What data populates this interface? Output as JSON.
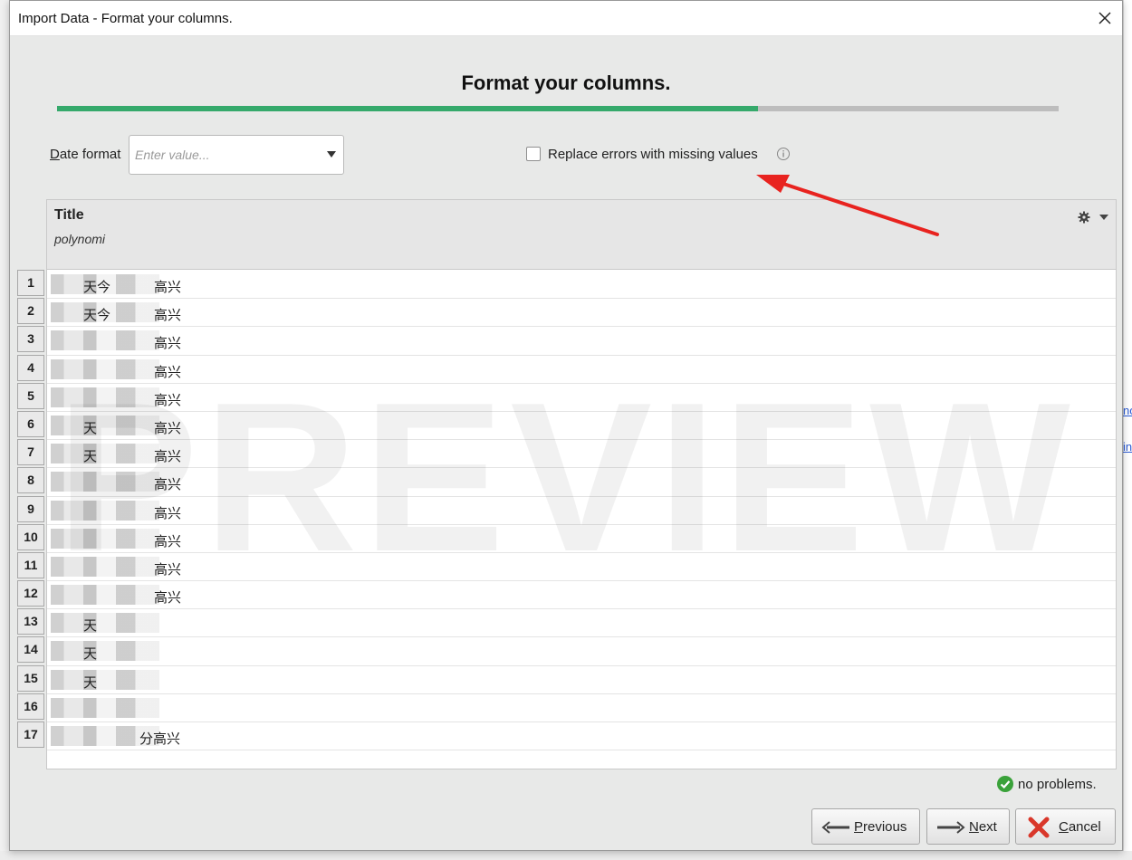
{
  "window": {
    "title": "Import Data - Format your columns."
  },
  "wizard": {
    "heading": "Format your columns.",
    "progress_fraction": 0.7,
    "progress_color": "#35a96b"
  },
  "date_format": {
    "label": "Date format",
    "placeholder": "Enter value..."
  },
  "replace_errors": {
    "label": "Replace errors with missing values",
    "checked": false
  },
  "column": {
    "title": "Title",
    "type_hint": "polynomi"
  },
  "rows": [
    {
      "num": "1",
      "text": "天今",
      "tail": "高兴"
    },
    {
      "num": "2",
      "text": "天今",
      "tail": "高兴"
    },
    {
      "num": "3",
      "text": "",
      "tail": "高兴"
    },
    {
      "num": "4",
      "text": "",
      "tail": "高兴"
    },
    {
      "num": "5",
      "text": "",
      "tail": "高兴"
    },
    {
      "num": "6",
      "text": "天",
      "tail": "高兴"
    },
    {
      "num": "7",
      "text": "天",
      "tail": "高兴"
    },
    {
      "num": "8",
      "text": "",
      "tail": "高兴"
    },
    {
      "num": "9",
      "text": "",
      "tail": "高兴"
    },
    {
      "num": "10",
      "text": "",
      "tail": "高兴"
    },
    {
      "num": "11",
      "text": "",
      "tail": "高兴"
    },
    {
      "num": "12",
      "text": "",
      "tail": "高兴"
    },
    {
      "num": "13",
      "text": "天",
      "tail": ""
    },
    {
      "num": "14",
      "text": "天",
      "tail": ""
    },
    {
      "num": "15",
      "text": "天",
      "tail": ""
    },
    {
      "num": "16",
      "text": "",
      "tail": ""
    },
    {
      "num": "17",
      "text": "",
      "tail": "分高兴"
    }
  ],
  "watermark": "PREVIEW",
  "status": {
    "text": "no problems.",
    "icon": "check-circle-icon",
    "color": "#3aa23a"
  },
  "buttons": {
    "previous": "Previous",
    "next": "Next",
    "cancel": "Cancel"
  },
  "annotation_arrow": {
    "color": "#e8231f"
  },
  "background_links": [
    "no",
    "in"
  ]
}
